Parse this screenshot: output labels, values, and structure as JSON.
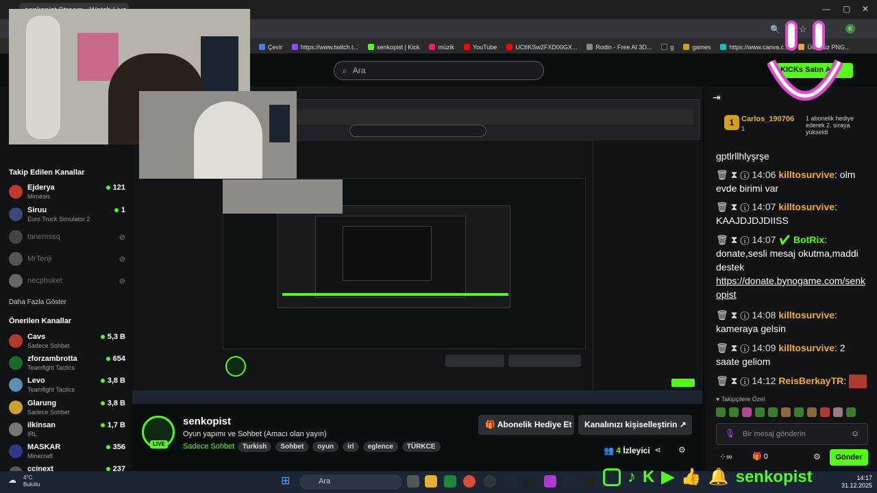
{
  "browser": {
    "tab_title": "senkopist Stream - Watch Live",
    "bookmarks": [
      "Çevir",
      "https://www.twitch.t...",
      "senkopist | Kick",
      "müzik",
      "YouTube",
      "UCtIKSw2FXD00GX...",
      "Rodin - Free AI 3D...",
      "g",
      "games",
      "https://www.canva.c...",
      "Ücretsiz PNG..."
    ]
  },
  "header": {
    "search_placeholder": "Ara",
    "kicks_button": "KICKs Satın Al"
  },
  "sidebar": {
    "followed_title": "Takip Edilen Kanallar",
    "followed": [
      {
        "name": "Ejderya",
        "game": "Mimesis",
        "viewers": "121",
        "color": "#c0392b"
      },
      {
        "name": "Siruu",
        "game": "Euro Truck Simulator 2",
        "viewers": "1",
        "color": "#3a4a7a"
      }
    ],
    "offline": [
      {
        "name": "tanemssq",
        "color": "#444"
      },
      {
        "name": "MrTenji",
        "color": "#555"
      },
      {
        "name": "necphuket",
        "color": "#666"
      }
    ],
    "show_more": "Daha Fazla Göster",
    "recommended_title": "Önerilen Kanallar",
    "recommended": [
      {
        "name": "Cavs",
        "game": "Sadece Sohbet",
        "viewers": "5,3 B",
        "color": "#b03a2e"
      },
      {
        "name": "zforzambrotta",
        "game": "Teamfight Tactics",
        "viewers": "654",
        "color": "#1a6b2a"
      },
      {
        "name": "Levo",
        "game": "Teamfight Tactics",
        "viewers": "3,8 B",
        "color": "#5f8fb0"
      },
      {
        "name": "Glarung",
        "game": "Sadece Sohbet",
        "viewers": "3,8 B",
        "color": "#c9a227"
      },
      {
        "name": "ilkinsan",
        "game": "IRL",
        "viewers": "1,7 B",
        "color": "#777"
      },
      {
        "name": "MASKAR",
        "game": "Minecraft",
        "viewers": "356",
        "color": "#2a3a8a"
      },
      {
        "name": "ccinext",
        "game": "",
        "viewers": "237",
        "color": "#555"
      }
    ]
  },
  "stream": {
    "channel": "senkopist",
    "title": "Oyun yapımı ve Sohbet (Amacı olan yayın)",
    "category": "Sadece Sohbet",
    "tags": [
      "Turkish",
      "Sohbet",
      "oyun",
      "irl",
      "eglence",
      "TÜRKCE"
    ],
    "live_badge": "LIVE",
    "gift_button": "Abonelik Hediye Et",
    "customize_button": "Kanalınızı kişiselleştirin",
    "viewers_count": "4",
    "viewers_label": "İzleyici"
  },
  "chat": {
    "pinned_user": "Carlos_190706",
    "pinned_rank": "1",
    "pinned_count": "1",
    "pinned_text": "1 abonelik hediye ederek 2. sıraya yükseldi",
    "top_text": "gptlrllhlyşrşe",
    "messages": [
      {
        "time": "14:06",
        "user": "killtosurvive",
        "text": "olm evde birimi var"
      },
      {
        "time": "14:07",
        "user": "killtosurvive",
        "text": "KAAJDJDJDIISS"
      },
      {
        "time": "14:07",
        "user": "BotRix",
        "text": "donate,sesli mesaj okutma,maddi destek",
        "link": "https://donate.bynogame.com/senkopist"
      },
      {
        "time": "14:08",
        "user": "killtosurvive",
        "text": "kameraya gelsin"
      },
      {
        "time": "14:09",
        "user": "killtosurvive",
        "text": "2 saate geliom"
      },
      {
        "time": "14:12",
        "user": "ReisBerkayTR",
        "text": ""
      }
    ],
    "subs_only": "Takipçilere Özel",
    "input_placeholder": "Bir mesaj gönderin",
    "kicks_count": "0",
    "send_button": "Gönder"
  },
  "taskbar": {
    "weather_temp": "4°C",
    "weather_desc": "Bulutlu",
    "search": "Ara",
    "time": "14:17",
    "date": "31.12.2025"
  },
  "overlay": {
    "social_name": "senkopist"
  }
}
